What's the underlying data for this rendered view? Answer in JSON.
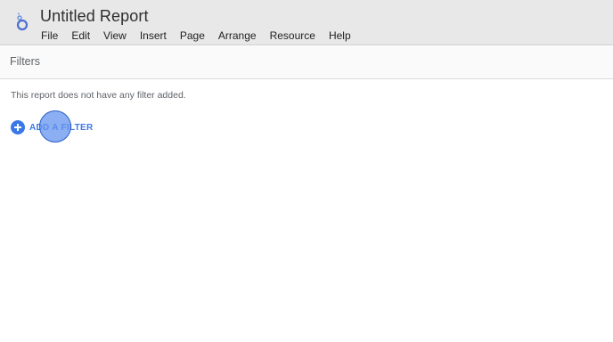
{
  "app": {
    "title": "Untitled Report",
    "logo_icon": "looker-studio-logo-icon"
  },
  "menu": {
    "items": [
      {
        "label": "File"
      },
      {
        "label": "Edit"
      },
      {
        "label": "View"
      },
      {
        "label": "Insert"
      },
      {
        "label": "Page"
      },
      {
        "label": "Arrange"
      },
      {
        "label": "Resource"
      },
      {
        "label": "Help"
      }
    ]
  },
  "filters_panel": {
    "title": "Filters",
    "empty_message": "This report does not have any filter added.",
    "add_filter_label": "ADD A FILTER",
    "add_icon": "plus-circle-icon"
  },
  "colors": {
    "header_bg": "#e8e8e8",
    "accent": "#3b78e7",
    "muted_text": "#5f6368"
  }
}
